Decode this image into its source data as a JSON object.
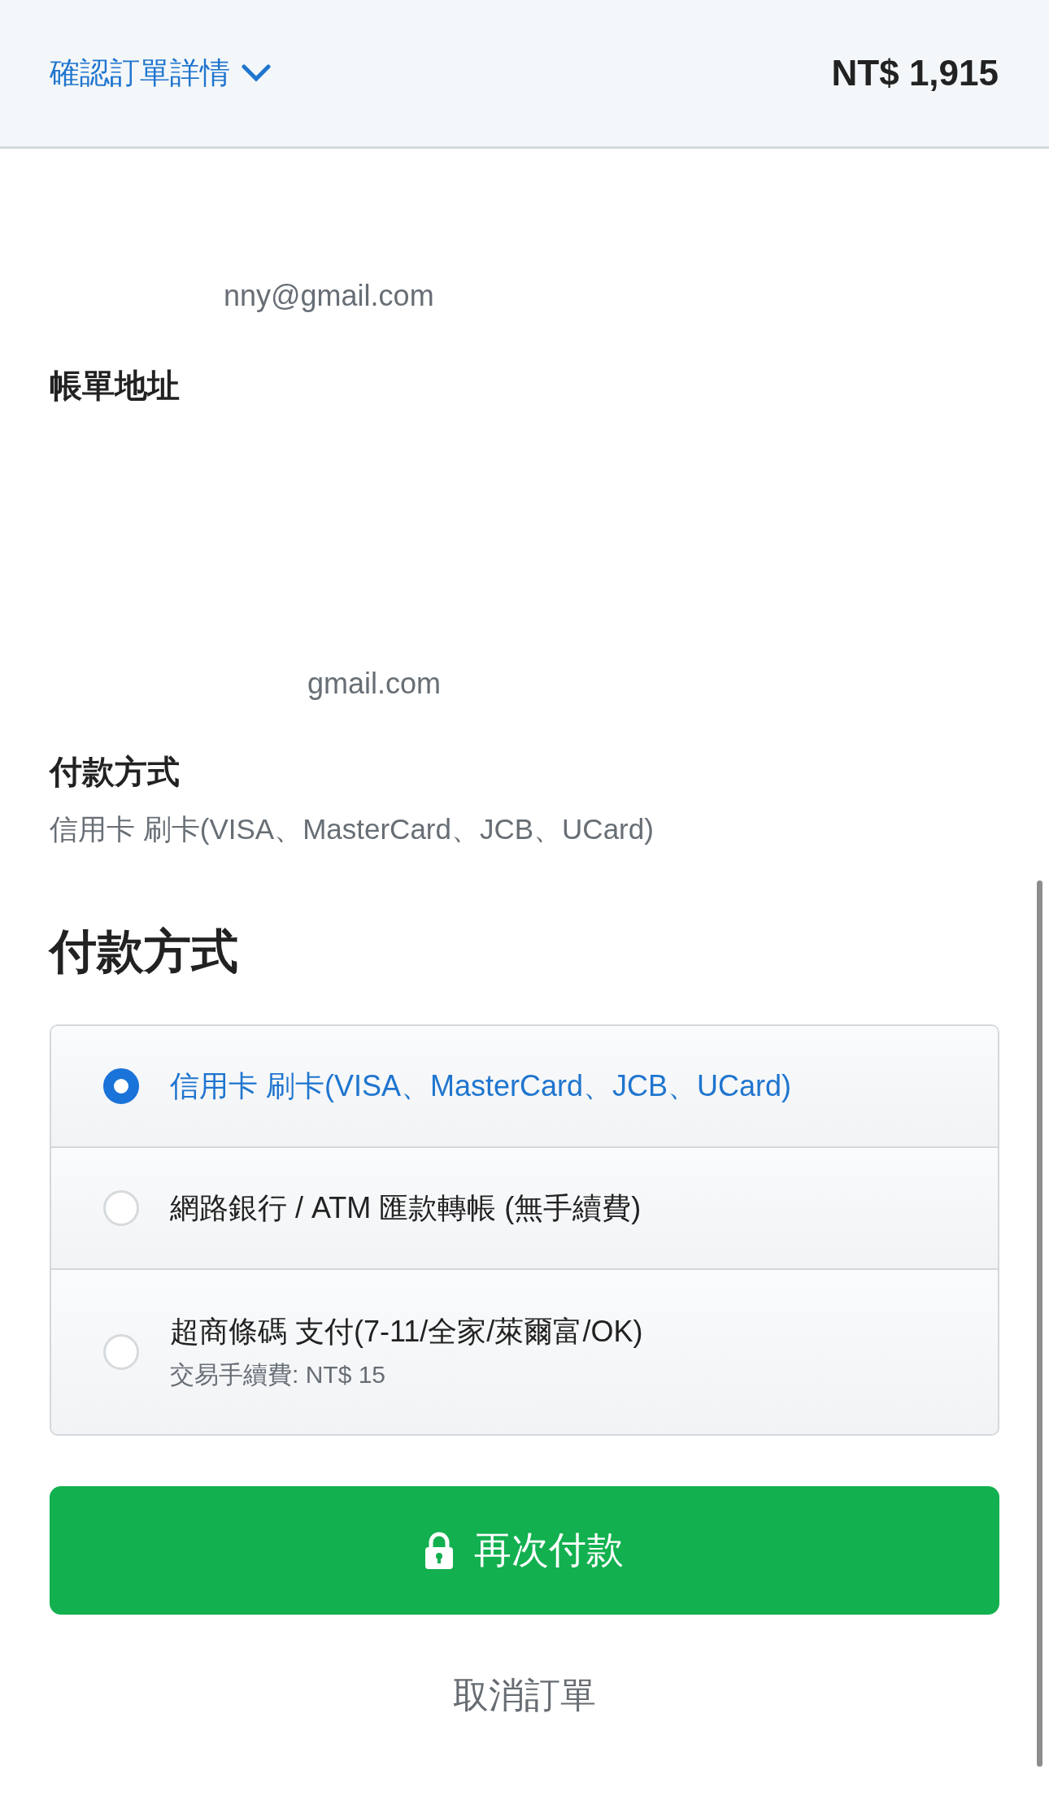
{
  "header": {
    "title": "確認訂單詳情",
    "total": "NT$ 1,915"
  },
  "contact": {
    "email": "nny@gmail.com"
  },
  "billing": {
    "heading": "帳單地址",
    "email": "gmail.com"
  },
  "payment_summary": {
    "heading": "付款方式",
    "value": "信用卡 刷卡(VISA、MasterCard、JCB、UCard)"
  },
  "payment_section": {
    "heading": "付款方式",
    "options": [
      {
        "label": "信用卡 刷卡(VISA、MasterCard、JCB、UCard)",
        "selected": true
      },
      {
        "label": "網路銀行 / ATM 匯款轉帳 (無手續費)",
        "selected": false
      },
      {
        "label": "超商條碼 支付(7-11/全家/萊爾富/OK)",
        "note": "交易手續費: NT$ 15",
        "selected": false
      }
    ]
  },
  "pay_button": "再次付款",
  "cancel_link": "取消訂單"
}
